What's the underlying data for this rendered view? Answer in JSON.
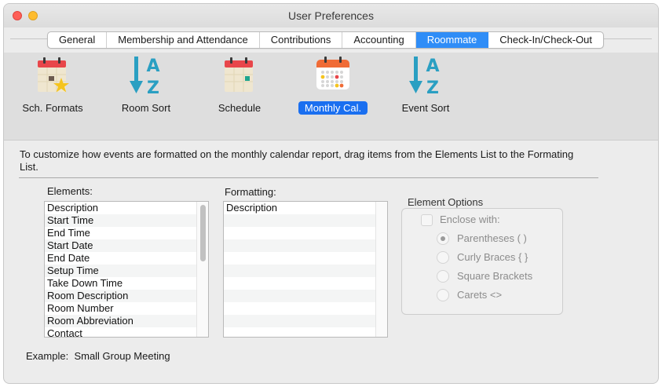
{
  "window": {
    "title": "User Preferences"
  },
  "tabs": [
    {
      "label": "General",
      "active": false
    },
    {
      "label": "Membership and Attendance",
      "active": false
    },
    {
      "label": "Contributions",
      "active": false
    },
    {
      "label": "Accounting",
      "active": false
    },
    {
      "label": "Roommate",
      "active": true
    },
    {
      "label": "Check-In/Check-Out",
      "active": false
    }
  ],
  "toolbar": [
    {
      "label": "Sch. Formats",
      "icon": "schedule-formats-icon",
      "active": false
    },
    {
      "label": "Room Sort",
      "icon": "sort-az-icon",
      "active": false
    },
    {
      "label": "Schedule",
      "icon": "schedule-calendar-icon",
      "active": false
    },
    {
      "label": "Monthly Cal.",
      "icon": "monthly-calendar-icon",
      "active": true
    },
    {
      "label": "Event Sort",
      "icon": "sort-az-icon",
      "active": false
    }
  ],
  "instructions": "To customize how events are formatted on the monthly calendar report, drag items from the Elements List to the Formating List.",
  "elements": {
    "label": "Elements:",
    "items": [
      "Description",
      "Start Time",
      "End Time",
      "Start Date",
      "End Date",
      "Setup Time",
      "Take Down Time",
      "Room Description",
      "Room Number",
      "Room Abbreviation",
      "Contact"
    ]
  },
  "formatting": {
    "label": "Formatting:",
    "items": [
      "Description"
    ]
  },
  "element_options": {
    "title": "Element Options",
    "enclose_label": "Enclose with:",
    "enclose_checked": false,
    "choices": [
      "Parentheses ( )",
      "Curly Braces { }",
      "Square Brackets",
      "Carets <>"
    ],
    "selected_index": 0
  },
  "example": {
    "label": "Example:",
    "value": "Small Group Meeting"
  },
  "colors": {
    "accent": "#2f8df7",
    "selection": "#1a6ff0",
    "sort_teal": "#2a9fc2",
    "calendar_red": "#e8464a"
  }
}
